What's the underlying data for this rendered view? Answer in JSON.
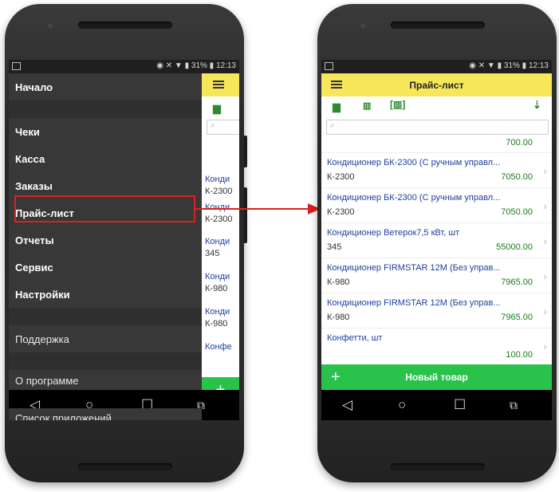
{
  "status_bar": {
    "battery": "31%",
    "time": "12:13"
  },
  "drawer": {
    "home": "Начало",
    "items": [
      "Чеки",
      "Касса",
      "Заказы",
      "Прайс-лист",
      "Отчеты",
      "Сервис",
      "Настройки"
    ],
    "support": "Поддержка",
    "about": "О программе",
    "apps": "Список приложений"
  },
  "behind_list": [
    {
      "line1": "Конди",
      "line2": "К-2300"
    },
    {
      "line1": "Конди",
      "line2": "К-2300"
    },
    {
      "line1": "Конди",
      "line2": "345"
    },
    {
      "line1": "Конди",
      "line2": "К-980"
    },
    {
      "line1": "Конди",
      "line2": "К-980"
    },
    {
      "line1": "Конфе",
      "line2": ""
    }
  ],
  "header": {
    "title": "Прайс-лист"
  },
  "list": {
    "partial_price": "700.00",
    "items": [
      {
        "name": "Кондиционер БК-2300 (С ручным управл...",
        "code": "К-2300",
        "price": "7050.00"
      },
      {
        "name": "Кондиционер БК-2300 (С ручным управл...",
        "code": "К-2300",
        "price": "7050.00"
      },
      {
        "name": "Кондиционер Ветерок7,5 кВт, шт",
        "code": "345",
        "price": "55000.00"
      },
      {
        "name": "Кондиционер FIRMSTAR 12М (Без управ...",
        "code": "К-980",
        "price": "7965.00"
      },
      {
        "name": "Кондиционер FIRMSTAR 12М (Без управ...",
        "code": "К-980",
        "price": "7965.00"
      },
      {
        "name": "Конфетти, шт",
        "code": "",
        "price": "100.00"
      }
    ]
  },
  "new_item_label": "Новый товар",
  "icons": [
    "menu-icon",
    "folder-search-icon",
    "barcode-search-icon",
    "barcode-scan-icon",
    "sort-az-icon",
    "search-icon",
    "plus-icon",
    "back-icon",
    "home-icon",
    "recents-icon",
    "screenshot-icon"
  ],
  "colors": {
    "header_yellow": "#f6e65a",
    "accent_green": "#29c24a",
    "item_blue": "#1f3f9f",
    "price_green": "#1a7a1a",
    "highlight_red": "#e02020"
  }
}
